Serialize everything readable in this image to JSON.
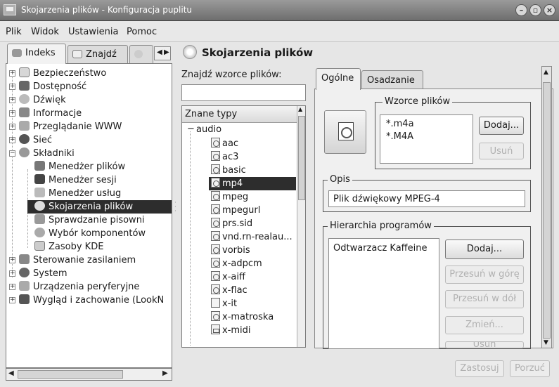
{
  "window": {
    "title": "Skojarzenia plików - Konfiguracja puplitu",
    "controls": [
      "–",
      "▫",
      "×"
    ]
  },
  "menu": [
    "Plik",
    "Widok",
    "Ustawienia",
    "Pomoc"
  ],
  "left_tabs": [
    "Indeks",
    "Znajdź"
  ],
  "tree": [
    {
      "label": "Bezpieczeństwo",
      "expander": "+"
    },
    {
      "label": "Dostępność",
      "expander": "+"
    },
    {
      "label": "Dźwięk",
      "expander": "+"
    },
    {
      "label": "Informacje",
      "expander": "+"
    },
    {
      "label": "Przeglądanie WWW",
      "expander": "+"
    },
    {
      "label": "Sieć",
      "expander": "+"
    },
    {
      "label": "Składniki",
      "expander": "−"
    },
    {
      "label": "Menedżer plików"
    },
    {
      "label": "Menedżer sesji"
    },
    {
      "label": "Menedżer usług"
    },
    {
      "label": "Skojarzenia plików",
      "selected": true
    },
    {
      "label": "Sprawdzanie pisowni"
    },
    {
      "label": "Wybór komponentów"
    },
    {
      "label": "Zasoby KDE"
    },
    {
      "label": "Sterowanie zasilaniem",
      "expander": "+"
    },
    {
      "label": "System",
      "expander": "+"
    },
    {
      "label": "Urządzenia peryferyjne",
      "expander": "+"
    },
    {
      "label": "Wygląd i zachowanie (LookN",
      "expander": "+"
    }
  ],
  "main": {
    "title": "Skojarzenia plików",
    "find_label": "Znajdź wzorce plików:",
    "find_value": "",
    "known_types_header": "Znane typy",
    "group": "audio",
    "types": [
      "aac",
      "ac3",
      "basic",
      "mp4",
      "mpeg",
      "mpegurl",
      "prs.sid",
      "vnd.rn-realau...",
      "vorbis",
      "x-adpcm",
      "x-aiff",
      "x-flac",
      "x-it",
      "x-matroska",
      "x-midi"
    ],
    "selected_type": "mp4"
  },
  "tabs": [
    "Ogólne",
    "Osadzanie"
  ],
  "patterns": {
    "title": "Wzorce plików",
    "items": [
      "*.m4a",
      "*.M4A"
    ],
    "add": "Dodaj...",
    "remove": "Usuń"
  },
  "description": {
    "title": "Opis",
    "value": "Plik dźwiękowy MPEG-4"
  },
  "programs": {
    "title": "Hierarchia programów",
    "items": [
      "Odtwarzacz Kaffeine"
    ],
    "add": "Dodaj...",
    "move_up": "Przesuń w górę",
    "move_down": "Przesuń w dół",
    "change": "Zmień...",
    "remove": "Usuń"
  },
  "footer": {
    "apply": "Zastosuj",
    "reset": "Porzuć"
  }
}
